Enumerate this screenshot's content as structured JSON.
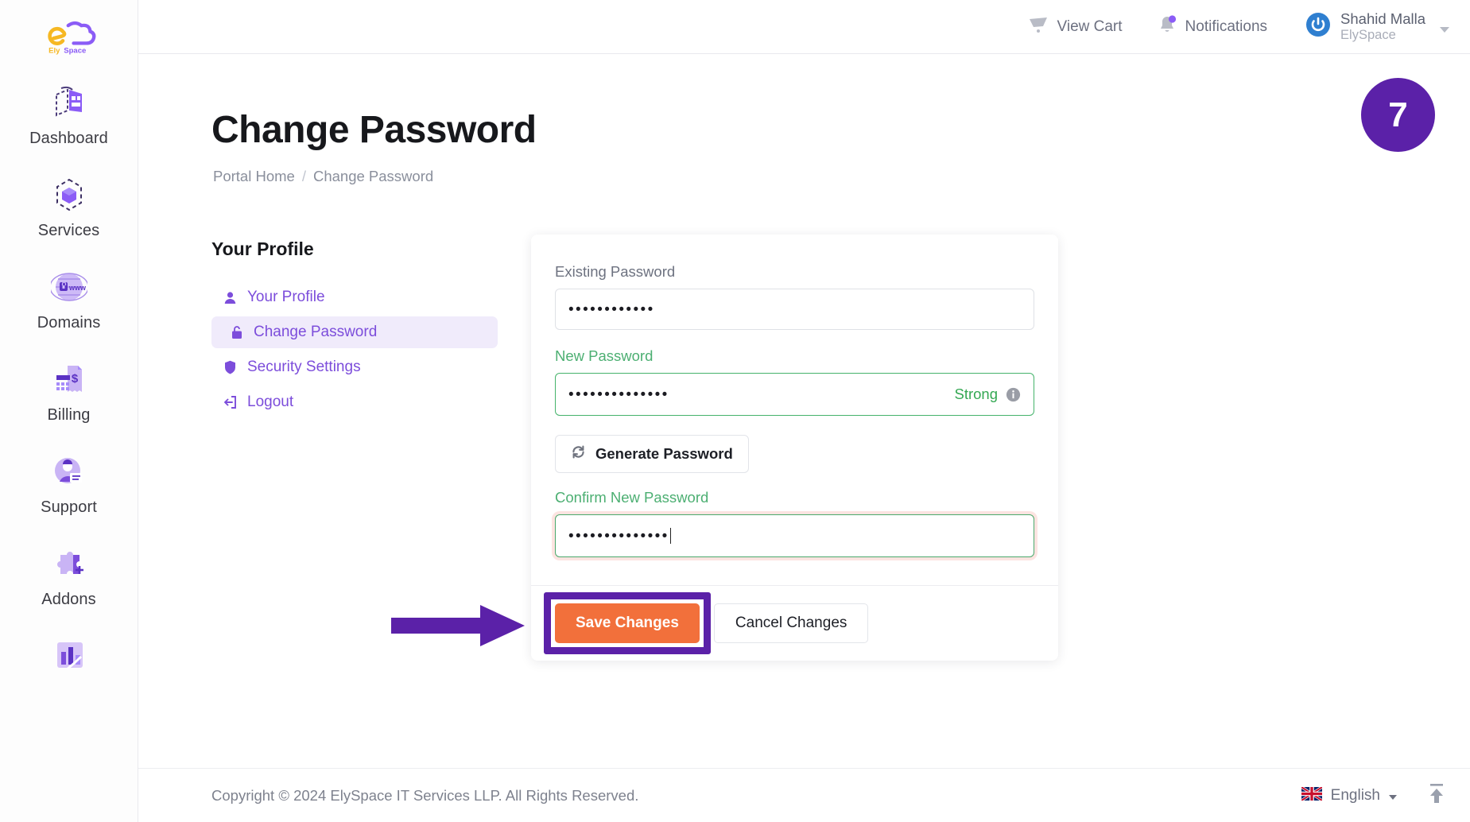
{
  "brand": {
    "name": "ElySpace",
    "logo_icon": "elyspace-cloud-logo"
  },
  "sidebar": {
    "items": [
      {
        "label": "Dashboard",
        "icon": "dashboard-icon"
      },
      {
        "label": "Services",
        "icon": "services-cube-icon"
      },
      {
        "label": "Domains",
        "icon": "domains-globe-www-icon"
      },
      {
        "label": "Billing",
        "icon": "billing-invoice-icon"
      },
      {
        "label": "Support",
        "icon": "support-agent-icon"
      },
      {
        "label": "Addons",
        "icon": "addons-puzzle-plus-icon"
      },
      {
        "label": "",
        "icon": "reports-bar-chart-icon"
      }
    ]
  },
  "header": {
    "cart": {
      "label": "View Cart",
      "icon": "cart-icon"
    },
    "notifications": {
      "label": "Notifications",
      "icon": "bell-icon",
      "has_badge": true,
      "badge_color": "#8b5cf6"
    },
    "user": {
      "name": "Shahid Malla",
      "org": "ElySpace",
      "avatar_icon": "power-circle-avatar",
      "avatar_color": "#2f7fd0"
    }
  },
  "step_badge": {
    "number": "7",
    "color": "#5b21a8"
  },
  "page": {
    "title": "Change Password",
    "breadcrumb": {
      "home": "Portal Home",
      "separator": "/",
      "current": "Change Password"
    }
  },
  "profile_nav": {
    "title": "Your Profile",
    "items": [
      {
        "label": "Your Profile",
        "icon": "user-icon",
        "active": false
      },
      {
        "label": "Change Password",
        "icon": "lock-icon",
        "active": true
      },
      {
        "label": "Security Settings",
        "icon": "shield-icon",
        "active": false
      },
      {
        "label": "Logout",
        "icon": "logout-icon",
        "active": false
      }
    ]
  },
  "form": {
    "existing_password": {
      "label": "Existing Password",
      "value": "••••••••••••",
      "state": "default"
    },
    "new_password": {
      "label": "New Password",
      "value": "••••••••••••••",
      "state": "valid",
      "strength_label": "Strong",
      "strength_color": "#34a853",
      "info_icon": "info-icon"
    },
    "generate_button": {
      "label": "Generate Password",
      "icon": "refresh-icon"
    },
    "confirm_password": {
      "label": "Confirm New Password",
      "value": "••••••••••••••",
      "state": "focused",
      "has_caret": true
    },
    "save_button": {
      "label": "Save Changes",
      "color": "#f2703b"
    },
    "cancel_button": {
      "label": "Cancel Changes"
    }
  },
  "annotation": {
    "highlight_color": "#5b21a8",
    "arrow": "right-arrow"
  },
  "footer": {
    "copyright": "Copyright © 2024 ElySpace IT Services LLP. All Rights Reserved.",
    "language": {
      "label": "English",
      "flag": "uk-flag-icon"
    },
    "scroll_top": {
      "icon": "arrow-up-to-line-icon"
    }
  }
}
